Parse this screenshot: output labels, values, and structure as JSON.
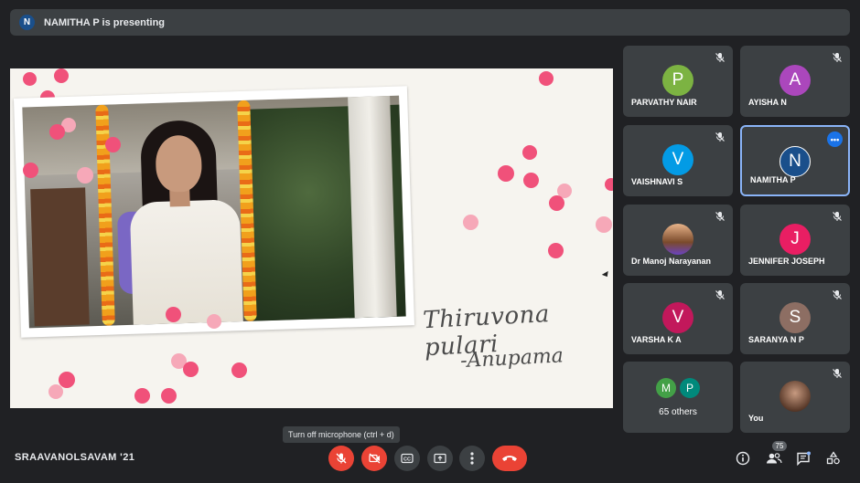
{
  "banner": {
    "avatar_letter": "N",
    "text": "NAMITHA P is presenting"
  },
  "presentation": {
    "caption_line1": "Thiruvona pulari",
    "caption_line2": "-Anupama"
  },
  "participants": [
    {
      "name": "PARVATHY NAIR",
      "initial": "P",
      "color": "#7cb342",
      "muted": true
    },
    {
      "name": "AYISHA N",
      "initial": "A",
      "color": "#ab47bc",
      "muted": true
    },
    {
      "name": "VAISHNAVI S",
      "initial": "V",
      "color": "#039be5",
      "muted": true
    },
    {
      "name": "NAMITHA P",
      "initial": "N",
      "color": "#1a4f8b",
      "muted": false,
      "more_menu": "•••"
    },
    {
      "name": "Dr Manoj Narayanan",
      "initial": "",
      "muted": true
    },
    {
      "name": "JENNIFER JOSEPH",
      "initial": "J",
      "color": "#e91e63",
      "muted": true
    },
    {
      "name": "VARSHA K A",
      "initial": "V",
      "color": "#c2185b",
      "muted": true
    },
    {
      "name": "SARANYA N P",
      "initial": "S",
      "color": "#8d6e63",
      "muted": true
    },
    {
      "name": "You",
      "initial": "",
      "muted": true
    }
  ],
  "others_tile": {
    "label": "65 others",
    "initials": [
      "M",
      "P"
    ],
    "colors": [
      "#43a047",
      "#00897b"
    ]
  },
  "tooltip": "Turn off microphone (ctrl + d)",
  "meeting_name": "SRAAVANOLSAVAM '21",
  "people_count": "75",
  "icons": {
    "mic": "mic-off-icon",
    "camera": "camera-off-icon",
    "captions": "captions-icon",
    "present": "present-screen-icon",
    "more": "more-vert-icon",
    "hangup": "hang-up-icon",
    "info": "info-icon",
    "people": "people-icon",
    "chat": "chat-icon",
    "activities": "activities-icon"
  },
  "colors": {
    "background": "#202124",
    "tile": "#3c4043",
    "danger": "#ea4335",
    "accent": "#8ab4f8"
  }
}
